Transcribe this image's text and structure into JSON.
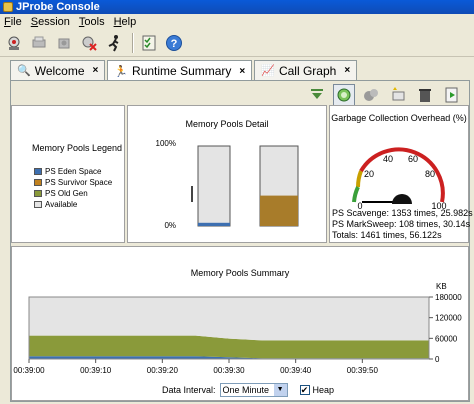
{
  "window": {
    "title": "JProbe Console"
  },
  "menu": [
    {
      "pre": "",
      "u": "F",
      "post": "ile"
    },
    {
      "pre": "",
      "u": "S",
      "post": "ession"
    },
    {
      "pre": "",
      "u": "T",
      "post": "ools"
    },
    {
      "pre": "",
      "u": "H",
      "post": "elp"
    }
  ],
  "toolbar": [
    "connect-icon",
    "print-icon",
    "snapshot-icon",
    "disconnect-icon",
    "run-icon",
    "checklist-icon",
    "help-icon"
  ],
  "tabs": [
    {
      "label": "Welcome",
      "close": "×",
      "active": false
    },
    {
      "label": "Runtime Summary",
      "close": "×",
      "active": true
    },
    {
      "label": "Call Graph",
      "close": "×",
      "active": false
    }
  ],
  "legend": {
    "title": "Memory Pools Legend",
    "items": [
      {
        "label": "PS Eden Space",
        "color": "#3d6fb0"
      },
      {
        "label": "PS Survivor Space",
        "color": "#c1811e"
      },
      {
        "label": "PS Old Gen",
        "color": "#8a9a3a"
      },
      {
        "label": "Available",
        "color": "#e4e4e4"
      }
    ]
  },
  "detail": {
    "title": "Memory Pools Detail",
    "top_label": "100%",
    "bottom_label": "0%",
    "bars": [
      {
        "fill_fraction": 0.04,
        "color": "#3d6fb0"
      },
      {
        "fill_fraction": 0.38,
        "color": "#a87c2a"
      }
    ]
  },
  "gc": {
    "title": "Garbage Collection Overhead (%)",
    "gauge": {
      "min": 0,
      "max": 100,
      "value": 0,
      "ticks": [
        "0",
        "20",
        "40",
        "60",
        "80",
        "100"
      ]
    },
    "lines": [
      "PS Scavenge: 1353 times, 25.982s",
      "PS MarkSweep: 108 times, 30.14s",
      "Totals: 1461 times, 56.122s"
    ]
  },
  "summary": {
    "title": "Memory Pools Summary",
    "unit": "KB",
    "interval_label": "Data Interval:",
    "interval_value": "One Minute",
    "heap_label": "Heap",
    "heap_checked": true,
    "check_mark": "✔"
  },
  "chart_data": {
    "type": "area",
    "title": "Memory Pools Summary",
    "ylabel": "KB",
    "ylim": [
      0,
      180000
    ],
    "y_ticks": [
      "180000",
      "120000",
      "60000",
      "0"
    ],
    "x_ticks": [
      "00:39:00",
      "00:39:10",
      "00:39:20",
      "00:39:30",
      "00:39:40",
      "00:39:50"
    ],
    "x": [
      0,
      25,
      30,
      35,
      40,
      50,
      60
    ],
    "series": [
      {
        "name": "PS Eden Space",
        "color": "#3d6fb0",
        "values": [
          8000,
          8000,
          5000,
          2000,
          2000,
          2000,
          2000
        ]
      },
      {
        "name": "PS Old Gen",
        "color": "#8a9a3a",
        "values": [
          60000,
          60000,
          54000,
          52000,
          52000,
          52000,
          52000
        ]
      },
      {
        "name": "Available",
        "color": "#e4e4e4",
        "values": [
          112000,
          112000,
          121000,
          126000,
          126000,
          126000,
          126000
        ]
      }
    ]
  }
}
